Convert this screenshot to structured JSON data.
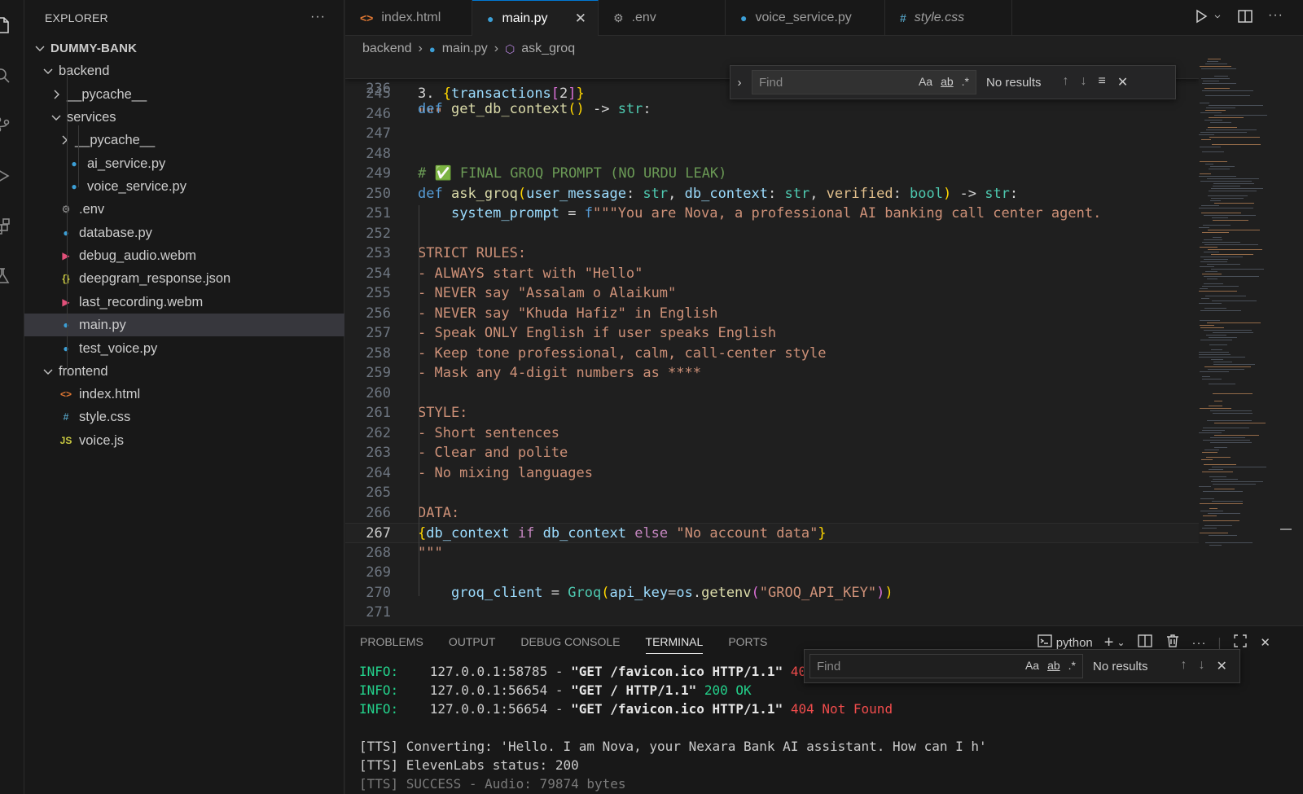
{
  "explorer": {
    "title": "EXPLORER",
    "more": "···",
    "tree": [
      {
        "label": "DUMMY-BANK",
        "kind": "root"
      },
      {
        "label": "backend",
        "kind": "folder"
      },
      {
        "label": "__pycache__",
        "kind": "folder-closed"
      },
      {
        "label": "services",
        "kind": "folder"
      },
      {
        "label": "__pycache__",
        "kind": "folder-closed"
      },
      {
        "label": "ai_service.py",
        "kind": "python"
      },
      {
        "label": "voice_service.py",
        "kind": "python"
      },
      {
        "label": ".env",
        "kind": "env"
      },
      {
        "label": "database.py",
        "kind": "python"
      },
      {
        "label": "debug_audio.webm",
        "kind": "media"
      },
      {
        "label": "deepgram_response.json",
        "kind": "json"
      },
      {
        "label": "last_recording.webm",
        "kind": "media"
      },
      {
        "label": "main.py",
        "kind": "python"
      },
      {
        "label": "test_voice.py",
        "kind": "python"
      },
      {
        "label": "frontend",
        "kind": "folder"
      },
      {
        "label": "index.html",
        "kind": "html"
      },
      {
        "label": "style.css",
        "kind": "css"
      },
      {
        "label": "voice.js",
        "kind": "js"
      }
    ]
  },
  "tabs": [
    {
      "label": "index.html",
      "icon": "html-icon"
    },
    {
      "label": "main.py",
      "icon": "python-icon",
      "active": true
    },
    {
      "label": ".env",
      "icon": "gear-icon"
    },
    {
      "label": "voice_service.py",
      "icon": "python-icon"
    },
    {
      "label": "style.css",
      "icon": "css-icon"
    }
  ],
  "breadcrumb": [
    "backend",
    "main.py",
    "ask_groq"
  ],
  "editor": {
    "sticky_line": {
      "number": "236",
      "text": "def get_db_context() -> str:"
    },
    "lines": [
      {
        "n": "245",
        "text": "3. {transactions[2]}"
      },
      {
        "n": "246",
        "text": "\"\"\""
      },
      {
        "n": "247",
        "text": ""
      },
      {
        "n": "248",
        "text": ""
      },
      {
        "n": "249",
        "text": "# ✅ FINAL GROQ PROMPT (NO URDU LEAK)"
      },
      {
        "n": "250",
        "text": "def ask_groq(user_message: str, db_context: str, verified: bool) -> str:"
      },
      {
        "n": "251",
        "text": "    system_prompt = f\"\"\"You are Nova, a professional AI banking call center agent."
      },
      {
        "n": "252",
        "text": ""
      },
      {
        "n": "253",
        "text": "STRICT RULES:"
      },
      {
        "n": "254",
        "text": "- ALWAYS start with \"Hello\""
      },
      {
        "n": "255",
        "text": "- NEVER say \"Assalam o Alaikum\""
      },
      {
        "n": "256",
        "text": "- NEVER say \"Khuda Hafiz\" in English"
      },
      {
        "n": "257",
        "text": "- Speak ONLY English if user speaks English"
      },
      {
        "n": "258",
        "text": "- Keep tone professional, calm, call-center style"
      },
      {
        "n": "259",
        "text": "- Mask any 4-digit numbers as ****"
      },
      {
        "n": "260",
        "text": ""
      },
      {
        "n": "261",
        "text": "STYLE:"
      },
      {
        "n": "262",
        "text": "- Short sentences"
      },
      {
        "n": "263",
        "text": "- Clear and polite"
      },
      {
        "n": "264",
        "text": "- No mixing languages"
      },
      {
        "n": "265",
        "text": ""
      },
      {
        "n": "266",
        "text": "DATA:"
      },
      {
        "n": "267",
        "text": "{db_context if db_context else \"No account data\"}"
      },
      {
        "n": "268",
        "text": "\"\"\""
      },
      {
        "n": "269",
        "text": ""
      },
      {
        "n": "270",
        "text": "    groq_client = Groq(api_key=os.getenv(\"GROQ_API_KEY\"))"
      },
      {
        "n": "271",
        "text": ""
      }
    ],
    "current_line": "267"
  },
  "find_widget": {
    "placeholder": "Find",
    "match_case": "Aa",
    "whole_word": "ab",
    "regex": ".*",
    "result": "No results"
  },
  "panel": {
    "tabs": [
      "PROBLEMS",
      "OUTPUT",
      "DEBUG CONSOLE",
      "TERMINAL",
      "PORTS"
    ],
    "active_tab": "TERMINAL",
    "terminal_name": "python",
    "find": {
      "placeholder": "Find",
      "result": "No results"
    },
    "lines": [
      {
        "prefix": "INFO:",
        "addr": "127.0.0.1:58785",
        "req": "\"GET /favicon.ico HTTP/1.1\"",
        "status": "404",
        "status_color": "red"
      },
      {
        "prefix": "INFO:",
        "addr": "127.0.0.1:56654",
        "req": "\"GET / HTTP/1.1\"",
        "status": "200 OK",
        "status_color": "green"
      },
      {
        "prefix": "INFO:",
        "addr": "127.0.0.1:56654",
        "req": "\"GET /favicon.ico HTTP/1.1\"",
        "status": "404 Not Found",
        "status_color": "red"
      }
    ],
    "tts_lines": [
      "[TTS] Converting: 'Hello. I am Nova, your Nexara Bank AI assistant. How can I h'",
      "[TTS] ElevenLabs status: 200",
      "[TTS] SUCCESS - Audio: 79874 bytes"
    ]
  },
  "colors": {
    "accent": "#0078d4",
    "python": "#3c9fd6",
    "media": "#e2507a",
    "json": "#cbcb41",
    "html": "#e37933",
    "css": "#519aba",
    "js": "#cbcb41",
    "terminal_green": "#23d18b",
    "terminal_red": "#f14c4c"
  }
}
